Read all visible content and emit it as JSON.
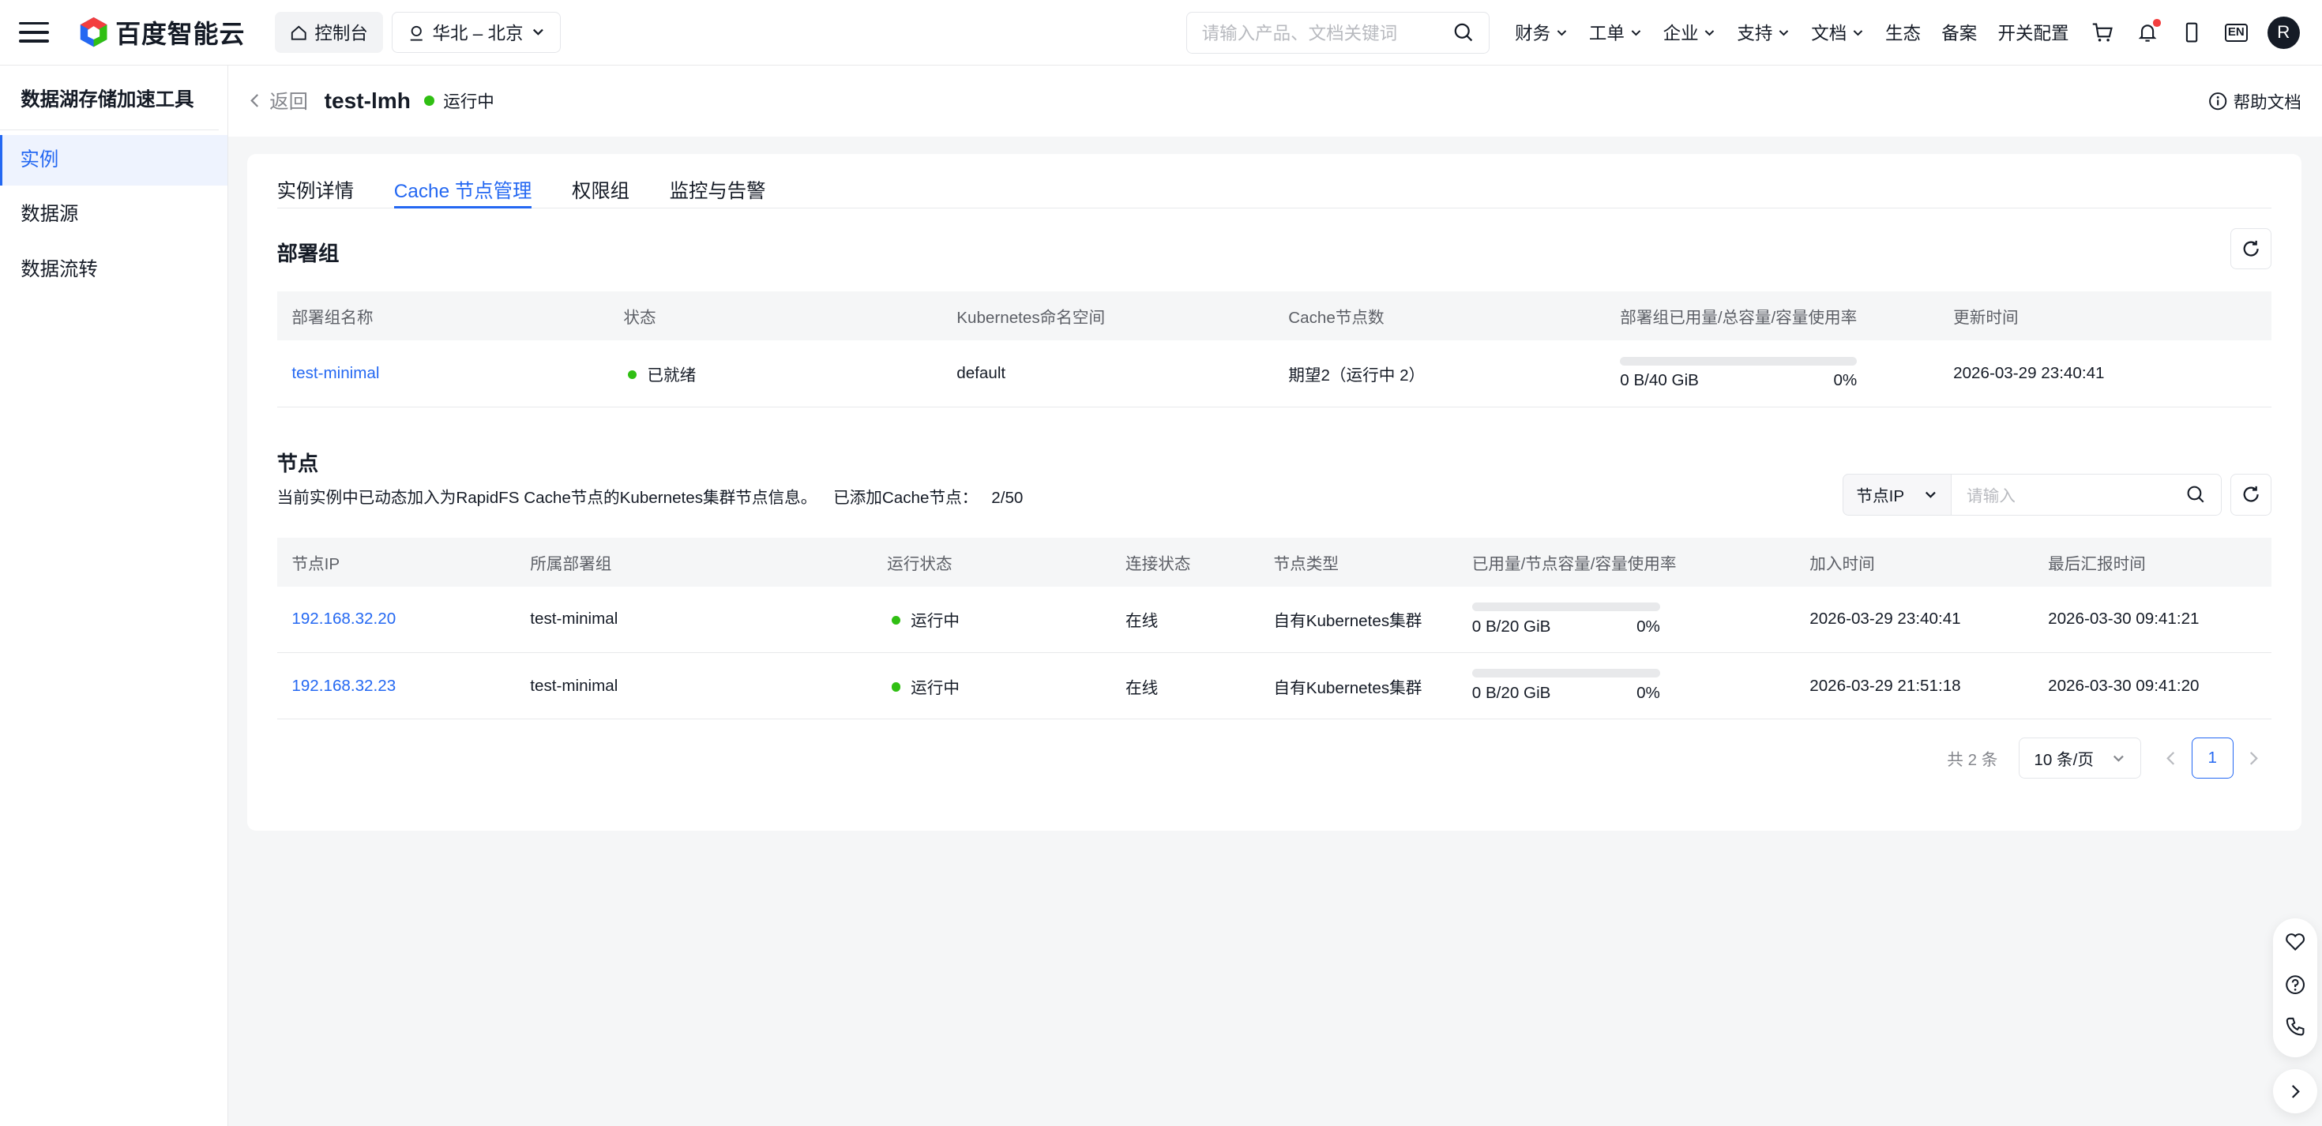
{
  "topbar": {
    "brand": "百度智能云",
    "console": "控制台",
    "region": "华北 – 北京",
    "search_placeholder": "请输入产品、文档关键词",
    "nav": [
      {
        "label": "财务",
        "dropdown": true
      },
      {
        "label": "工单",
        "dropdown": true
      },
      {
        "label": "企业",
        "dropdown": true
      },
      {
        "label": "支持",
        "dropdown": true
      },
      {
        "label": "文档",
        "dropdown": true
      },
      {
        "label": "生态",
        "dropdown": false
      },
      {
        "label": "备案",
        "dropdown": false
      },
      {
        "label": "开关配置",
        "dropdown": false
      }
    ],
    "lang": "EN",
    "avatar": "R"
  },
  "sidebar": {
    "title": "数据湖存储加速工具",
    "items": [
      {
        "label": "实例",
        "active": true
      },
      {
        "label": "数据源",
        "active": false
      },
      {
        "label": "数据流转",
        "active": false
      }
    ]
  },
  "header": {
    "back": "返回",
    "instance_name": "test-lmh",
    "status": "运行中",
    "help": "帮助文档"
  },
  "tabs": [
    "实例详情",
    "Cache 节点管理",
    "权限组",
    "监控与告警"
  ],
  "deploy_group": {
    "title": "部署组",
    "columns": [
      "部署组名称",
      "状态",
      "Kubernetes命名空间",
      "Cache节点数",
      "部署组已用量/总容量/容量使用率",
      "更新时间"
    ],
    "rows": [
      {
        "name": "test-minimal",
        "status": "已就绪",
        "namespace": "default",
        "nodes": "期望2（运行中 2）",
        "usage": "0 B/40 GiB",
        "rate": "0%",
        "rate_value": 0,
        "updated": "2026-03-29 23:40:41"
      }
    ]
  },
  "nodes": {
    "title": "节点",
    "desc": "当前实例中已动态加入为RapidFS Cache节点的Kubernetes集群节点信息。",
    "added_label": "已添加Cache节点：",
    "added_value": "2/50",
    "filter_select": "节点IP",
    "filter_placeholder": "请输入",
    "columns": [
      "节点IP",
      "所属部署组",
      "运行状态",
      "连接状态",
      "节点类型",
      "已用量/节点容量/容量使用率",
      "加入时间",
      "最后汇报时间"
    ],
    "rows": [
      {
        "ip": "192.168.32.20",
        "group": "test-minimal",
        "run": "运行中",
        "conn": "在线",
        "type": "自有Kubernetes集群",
        "usage": "0 B/20 GiB",
        "rate": "0%",
        "rate_value": 0,
        "joined": "2026-03-29 23:40:41",
        "reported": "2026-03-30 09:41:21"
      },
      {
        "ip": "192.168.32.23",
        "group": "test-minimal",
        "run": "运行中",
        "conn": "在线",
        "type": "自有Kubernetes集群",
        "usage": "0 B/20 GiB",
        "rate": "0%",
        "rate_value": 0,
        "joined": "2026-03-29 21:51:18",
        "reported": "2026-03-30 09:41:20"
      }
    ]
  },
  "pager": {
    "total": "共 2 条",
    "page_size": "10 条/页",
    "current": "1"
  },
  "colors": {
    "accent": "#2468f2",
    "success": "#30bf13",
    "alert": "#f33e3e"
  }
}
